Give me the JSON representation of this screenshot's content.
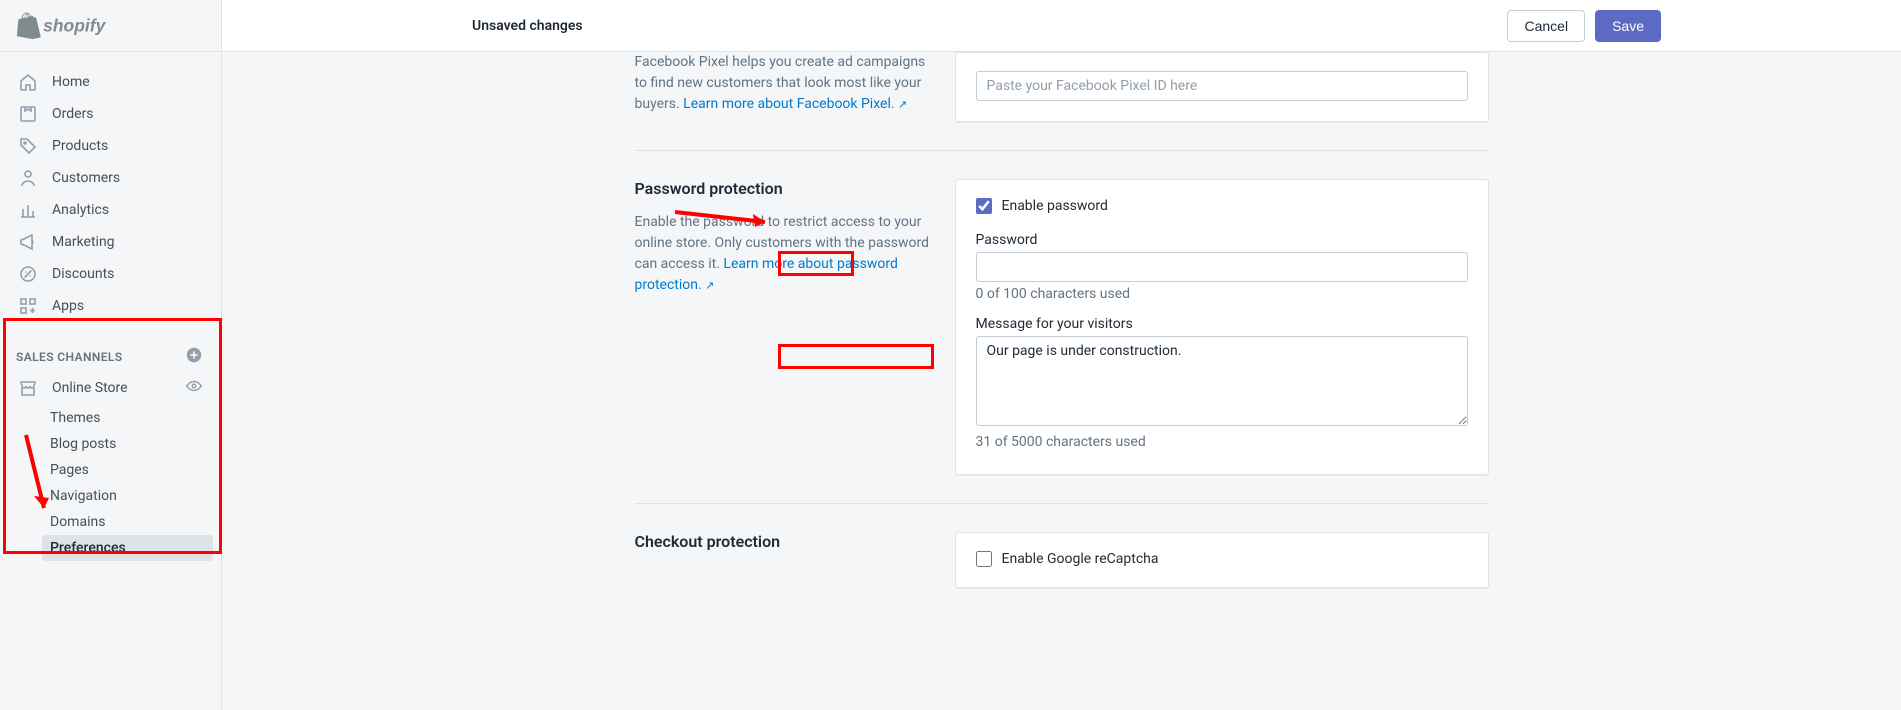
{
  "topbar": {
    "title": "Unsaved changes",
    "cancel": "Cancel",
    "save": "Save"
  },
  "nav": {
    "home": "Home",
    "orders": "Orders",
    "products": "Products",
    "customers": "Customers",
    "analytics": "Analytics",
    "marketing": "Marketing",
    "discounts": "Discounts",
    "apps": "Apps"
  },
  "salesChannels": {
    "header": "SALES CHANNELS",
    "onlineStore": "Online Store",
    "themes": "Themes",
    "blogPosts": "Blog posts",
    "pages": "Pages",
    "navigation": "Navigation",
    "domains": "Domains",
    "preferences": "Preferences"
  },
  "fbPixel": {
    "desc1": "Facebook Pixel helps you create ad campaigns to find new customers that look most like your buyers. ",
    "link": "Learn more about Facebook Pixel.",
    "placeholder": "Paste your Facebook Pixel ID here"
  },
  "password": {
    "title": "Password protection",
    "desc1": "Enable the password to restrict access to your online store. Only customers with the password can access it. ",
    "link": "Learn more about password protection.",
    "enableLabel": "Enable password",
    "passwordLabel": "Password",
    "passwordCount": "0 of 100 characters used",
    "messageLabel": "Message for your visitors",
    "messageValue": "Our page is under construction.",
    "messageCount": "31 of 5000 characters used"
  },
  "checkout": {
    "title": "Checkout protection",
    "recaptchaLabel": "Enable Google reCaptcha"
  }
}
